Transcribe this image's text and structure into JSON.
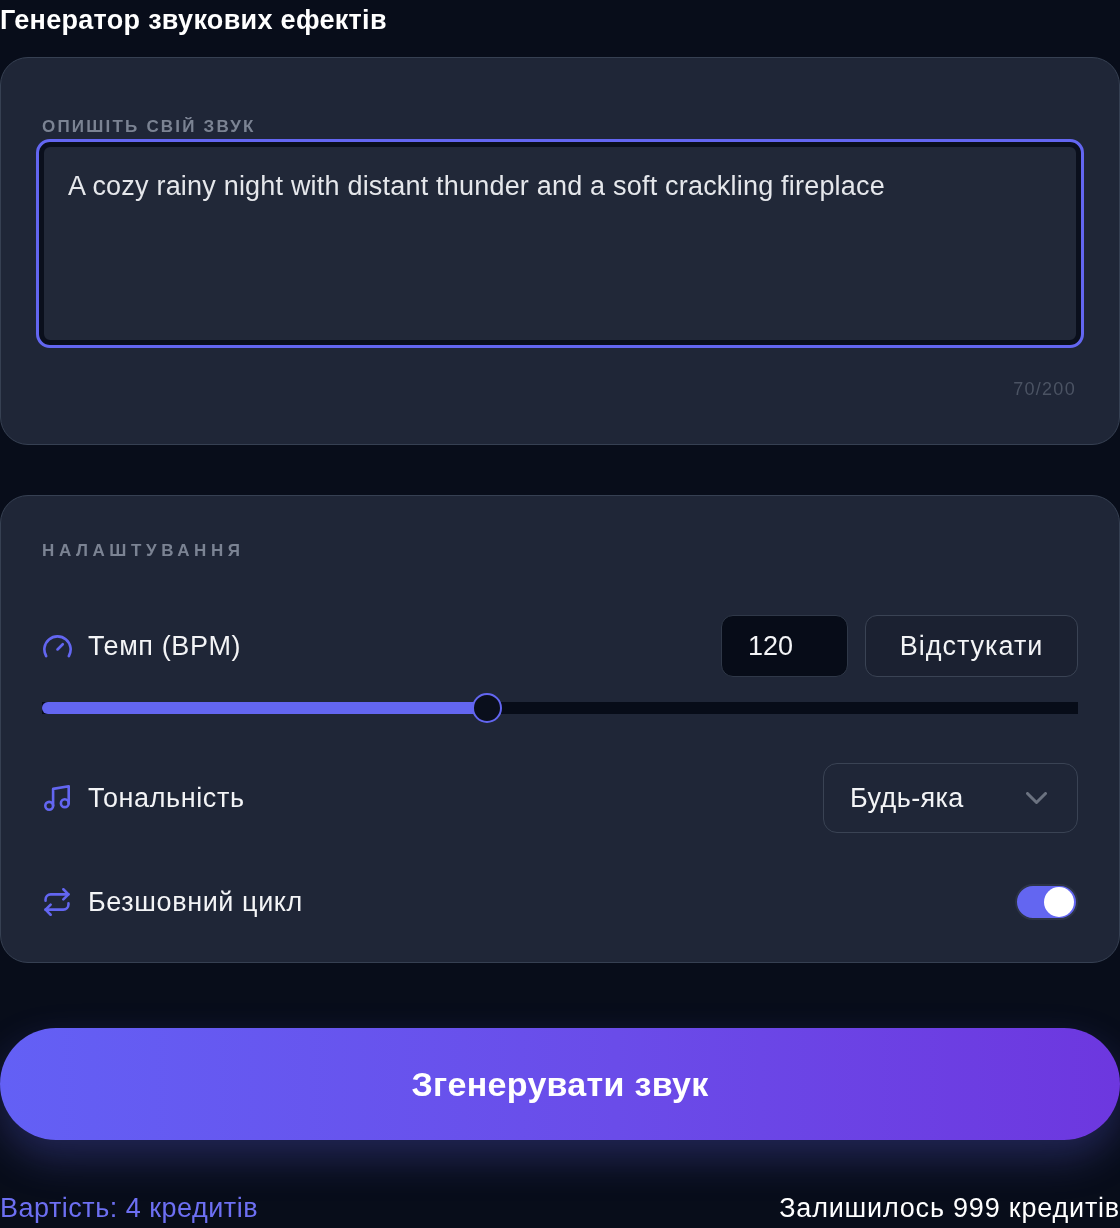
{
  "title": "Генератор звукових ефектів",
  "prompt": {
    "label": "ОПИШІТЬ СВІЙ ЗВУК",
    "value": "A cozy rainy night with distant thunder and a soft crackling fireplace",
    "focused": true,
    "counter": "70/200"
  },
  "settings": {
    "heading": "НАЛАШТУВАННЯ",
    "rows": [
      {
        "kind": "tempo",
        "label": "Темп (BPM)",
        "value": "120",
        "button": "Відстукати",
        "level": 0.43
      },
      {
        "kind": "select",
        "label": "Тональність",
        "value": "Будь-яка"
      },
      {
        "kind": "toggle",
        "label": "Безшовний цикл",
        "on": true
      }
    ]
  },
  "generate_button": "Згенерувати звук",
  "footer": {
    "cost": "Вартість: 4 кредитів",
    "remaining": "Залишилось 999 кредитів"
  }
}
